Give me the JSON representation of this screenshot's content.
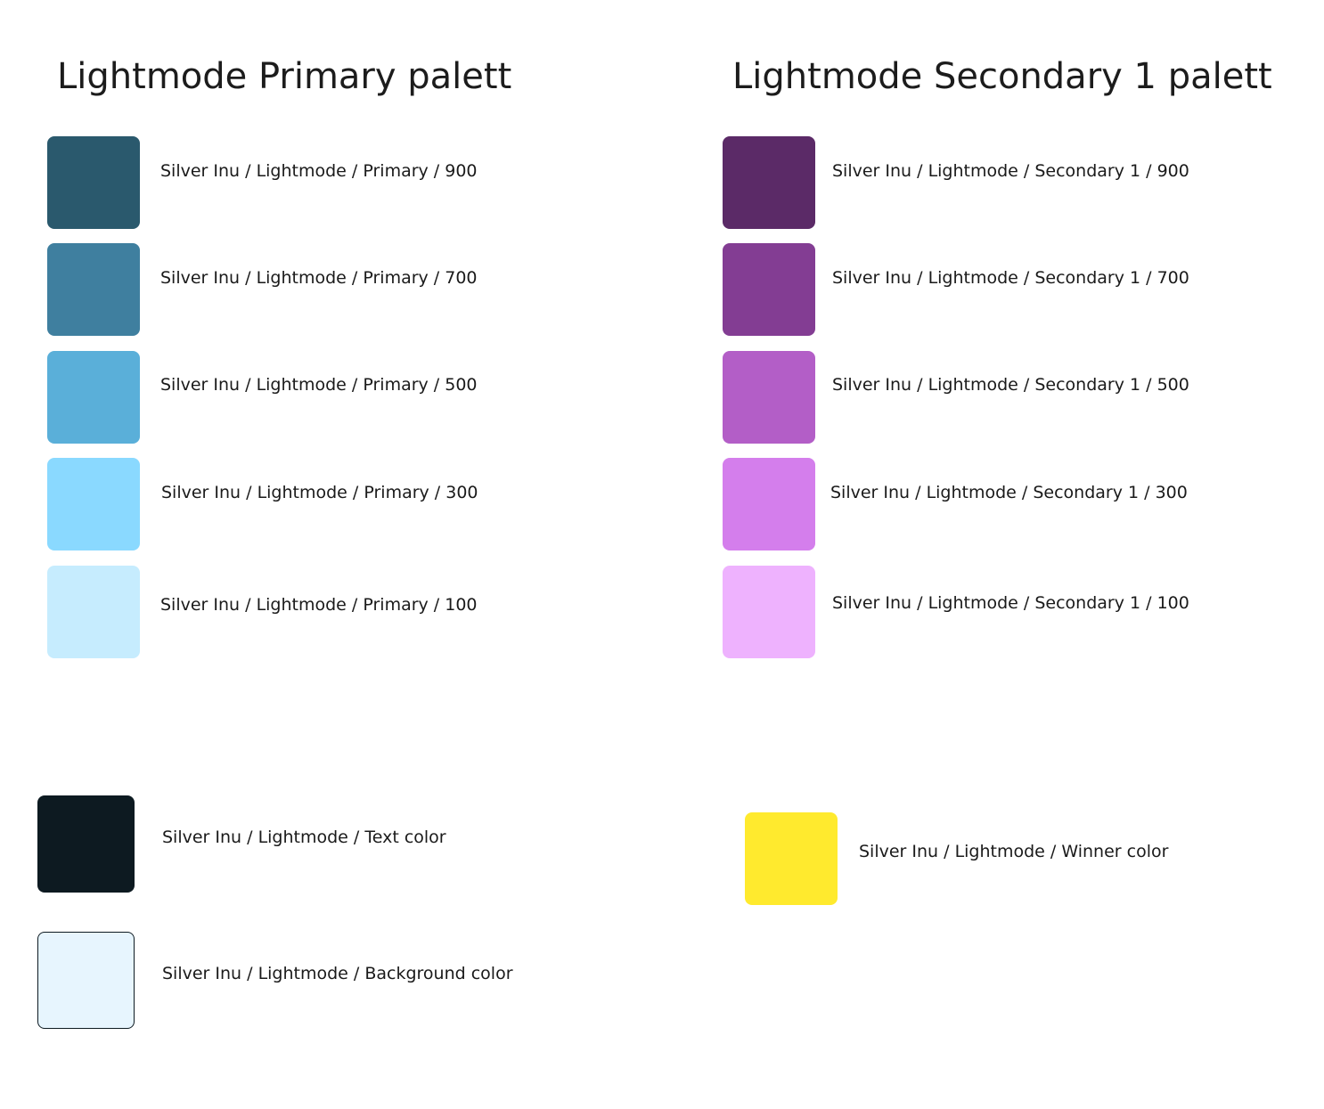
{
  "primary": {
    "title": "Lightmode Primary palett",
    "swatches": [
      {
        "label": "Silver Inu / Lightmode / Primary / 900",
        "color": "#2a596d"
      },
      {
        "label": "Silver Inu / Lightmode / Primary / 700",
        "color": "#3f7f9f"
      },
      {
        "label": "Silver Inu / Lightmode / Primary / 500",
        "color": "#5aafd9"
      },
      {
        "label": "Silver Inu / Lightmode / Primary / 300",
        "color": "#8ad9ff"
      },
      {
        "label": "Silver Inu / Lightmode / Primary / 100",
        "color": "#c6ecfe"
      }
    ]
  },
  "secondary": {
    "title": "Lightmode Secondary 1 palett",
    "swatches": [
      {
        "label": "Silver Inu / Lightmode / Secondary 1 / 900",
        "color": "#5b2a67"
      },
      {
        "label": "Silver Inu / Lightmode / Secondary 1 / 700",
        "color": "#833d93"
      },
      {
        "label": "Silver Inu / Lightmode / Secondary 1 / 500",
        "color": "#b35ec7"
      },
      {
        "label": "Silver Inu / Lightmode / Secondary 1 / 300",
        "color": "#d47eec"
      },
      {
        "label": "Silver Inu / Lightmode / Secondary 1 / 100",
        "color": "#eeb2fe"
      }
    ]
  },
  "extra": {
    "text_color": {
      "label": "Silver Inu / Lightmode / Text color",
      "color": "#0d1a21"
    },
    "background_color": {
      "label": "Silver Inu / Lightmode / Background color",
      "color": "#e7f5fe"
    },
    "winner_color": {
      "label": "Silver Inu / Lightmode / Winner color",
      "color": "#ffea2e"
    }
  }
}
